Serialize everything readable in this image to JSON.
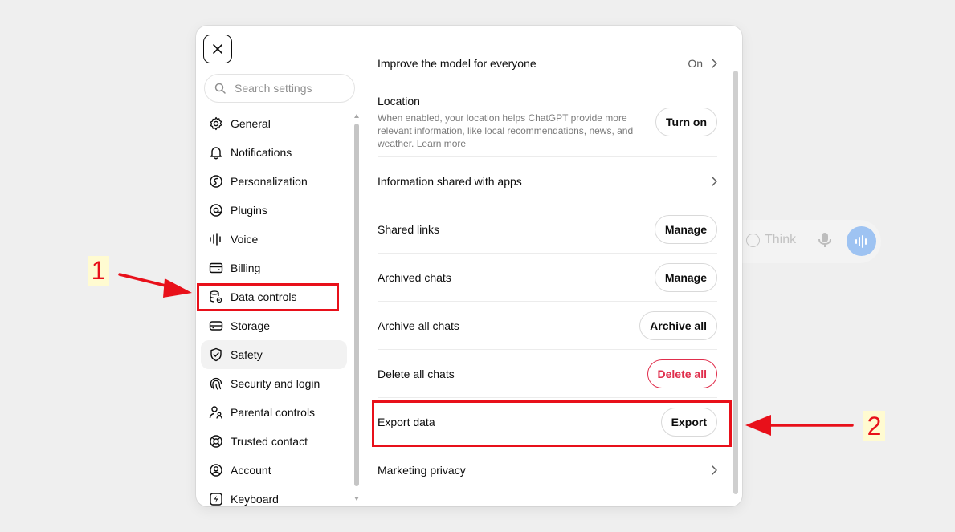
{
  "background": {
    "think_label": "Think"
  },
  "sidebar": {
    "search_placeholder": "Search settings",
    "items": [
      {
        "label": "General",
        "icon": "gear-icon"
      },
      {
        "label": "Notifications",
        "icon": "bell-icon"
      },
      {
        "label": "Personalization",
        "icon": "personalization-icon"
      },
      {
        "label": "Plugins",
        "icon": "plugins-icon"
      },
      {
        "label": "Voice",
        "icon": "voice-wave-icon"
      },
      {
        "label": "Billing",
        "icon": "credit-card-icon"
      },
      {
        "label": "Data controls",
        "icon": "database-gear-icon"
      },
      {
        "label": "Storage",
        "icon": "storage-drive-icon"
      },
      {
        "label": "Safety",
        "icon": "shield-check-icon",
        "active": true
      },
      {
        "label": "Security and login",
        "icon": "fingerprint-icon"
      },
      {
        "label": "Parental controls",
        "icon": "parent-child-icon"
      },
      {
        "label": "Trusted contact",
        "icon": "lifebuoy-icon"
      },
      {
        "label": "Account",
        "icon": "user-circle-icon"
      },
      {
        "label": "Keyboard",
        "icon": "keyboard-bolt-icon"
      }
    ]
  },
  "content": {
    "improve": {
      "label": "Improve the model for everyone",
      "value": "On"
    },
    "location": {
      "label": "Location",
      "description": "When enabled, your location helps ChatGPT provide more relevant information, like local recommendations, news, and weather.",
      "learn_more": "Learn more",
      "button": "Turn on"
    },
    "info_shared": {
      "label": "Information shared with apps"
    },
    "shared_links": {
      "label": "Shared links",
      "button": "Manage"
    },
    "archived_chats": {
      "label": "Archived chats",
      "button": "Manage"
    },
    "archive_all": {
      "label": "Archive all chats",
      "button": "Archive all"
    },
    "delete_all": {
      "label": "Delete all chats",
      "button": "Delete all"
    },
    "export": {
      "label": "Export data",
      "button": "Export"
    },
    "marketing": {
      "label": "Marketing privacy"
    }
  },
  "annotations": {
    "step1": "1",
    "step2": "2",
    "color": "#e8101a"
  },
  "colors": {
    "danger": "#e02e4c",
    "voice_button": "#9ec3f2"
  }
}
